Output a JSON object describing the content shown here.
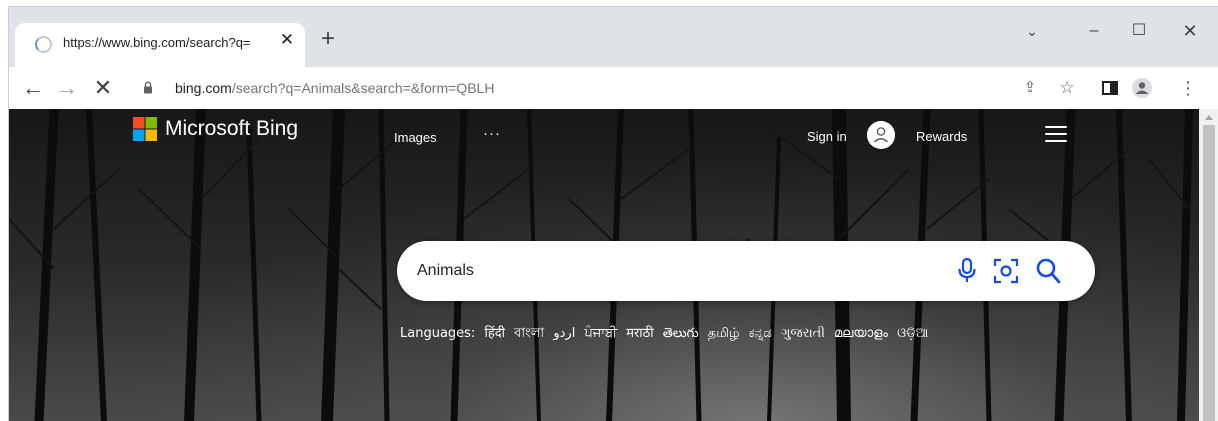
{
  "browser": {
    "tab": {
      "title": "https://www.bing.com/search?q=",
      "close": "✕",
      "loading_icon": "spinner-icon"
    },
    "new_tab": "+",
    "window_controls": {
      "dropdown": "⌄",
      "minimize": "–",
      "maximize": "☐",
      "close": "✕"
    },
    "nav": {
      "back": "←",
      "forward": "→",
      "stop": "✕"
    },
    "address": {
      "host": "bing.com",
      "path": "/search?q=Animals&search=&form=QBLH"
    },
    "toolbar_icons": {
      "share": "⇪",
      "star": "☆",
      "menu": "⋮"
    }
  },
  "page": {
    "brand": {
      "name": "Microsoft Bing",
      "logo_colors": [
        "#f25022",
        "#7fba00",
        "#00a4ef",
        "#ffb900"
      ]
    },
    "nav": {
      "images": "Images",
      "more": "···"
    },
    "header_right": {
      "signin": "Sign in",
      "rewards": "Rewards"
    },
    "search": {
      "value": "Animals",
      "accent": "#174ae4"
    },
    "languages": {
      "label": "Languages:",
      "items": [
        "हिंदी",
        "বাংলা",
        "اردو",
        "ਪੰਜਾਬੀ",
        "मराठी",
        "తెలుగు",
        "தமிழ்",
        "ಕನ್ನಡ",
        "ગુજરાતી",
        "മലയാളം",
        "ଓଡ଼ିଆ"
      ]
    }
  }
}
